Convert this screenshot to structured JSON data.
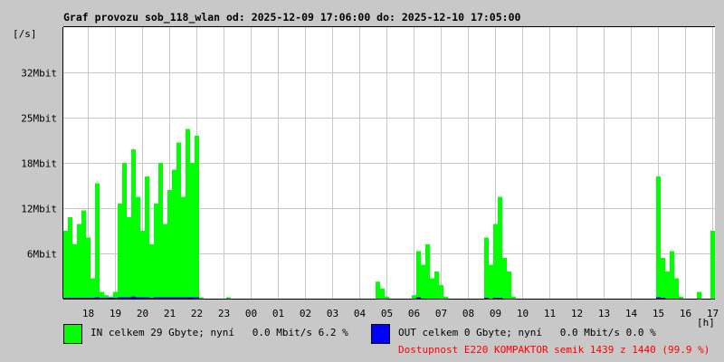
{
  "chart_data": {
    "type": "bar",
    "title": "Graf provozu sob_118_wlan od: 2025-12-09 17:06:00 do: 2025-12-10 17:05:00",
    "ylabel": "[/s]",
    "xlabel": "[h]",
    "ylim": [
      0,
      40
    ],
    "y_unit": "Mbit",
    "y_ticks": [
      {
        "value": 6.67,
        "label": "6Mbit"
      },
      {
        "value": 13.33,
        "label": "12Mbit"
      },
      {
        "value": 20,
        "label": "18Mbit"
      },
      {
        "value": 26.67,
        "label": "25Mbit"
      },
      {
        "value": 33.33,
        "label": "32Mbit"
      }
    ],
    "x_ticks": [
      "18",
      "19",
      "20",
      "21",
      "22",
      "23",
      "00",
      "01",
      "02",
      "03",
      "04",
      "05",
      "06",
      "07",
      "08",
      "09",
      "10",
      "11",
      "12",
      "13",
      "14",
      "15",
      "16",
      "17"
    ],
    "sample_interval_min": 10,
    "grid": true,
    "series": [
      {
        "name": "IN",
        "color": "#00ff00",
        "values": [
          10,
          12,
          8,
          11,
          13,
          9,
          3,
          17,
          1,
          0.5,
          0.3,
          1,
          14,
          20,
          12,
          22,
          15,
          10,
          18,
          8,
          14,
          20,
          11,
          16,
          19,
          23,
          15,
          25,
          20,
          24,
          0.2,
          0,
          0,
          0,
          0,
          0,
          0.2,
          0,
          0,
          0,
          0,
          0,
          0,
          0,
          0,
          0,
          0,
          0,
          0,
          0,
          0,
          0,
          0,
          0,
          0,
          0,
          0,
          0,
          0,
          0,
          0,
          0,
          0,
          0,
          0,
          0,
          0,
          0,
          0,
          2.5,
          1.5,
          0.3,
          0,
          0,
          0,
          0,
          0,
          0.5,
          7,
          5,
          8,
          3,
          4,
          2,
          0.3,
          0,
          0,
          0,
          0,
          0,
          0,
          0,
          0,
          9,
          5,
          11,
          15,
          6,
          4,
          0.3,
          0,
          0,
          0,
          0,
          0,
          0,
          0,
          0,
          0,
          0,
          0,
          0,
          0,
          0,
          0,
          0,
          0,
          0,
          0,
          0,
          0,
          0,
          0,
          0,
          0,
          0,
          0,
          0,
          0,
          0,
          0,
          18,
          6,
          4,
          7,
          3,
          0.3,
          0,
          0,
          0,
          1,
          0,
          0,
          10
        ]
      },
      {
        "name": "OUT",
        "color": "#0000ff",
        "values": [
          0.1,
          0.1,
          0.1,
          0.1,
          0.1,
          0.1,
          0.1,
          0.2,
          0.1,
          0.1,
          0.1,
          0.1,
          0.2,
          0.2,
          0.2,
          0.3,
          0.2,
          0.2,
          0.2,
          0.1,
          0.2,
          0.2,
          0.2,
          0.2,
          0.2,
          0.2,
          0.2,
          0.2,
          0.2,
          0.2,
          0,
          0,
          0,
          0,
          0,
          0,
          0,
          0,
          0,
          0,
          0,
          0,
          0,
          0,
          0,
          0,
          0,
          0,
          0,
          0,
          0,
          0,
          0,
          0,
          0,
          0,
          0,
          0,
          0,
          0,
          0,
          0,
          0,
          0,
          0,
          0,
          0,
          0,
          0,
          0,
          0,
          0,
          0,
          0,
          0,
          0,
          0,
          0,
          0.2,
          0,
          0,
          0,
          0,
          0,
          0,
          0,
          0,
          0,
          0,
          0,
          0,
          0,
          0,
          0.1,
          0,
          0.1,
          0.1,
          0,
          0,
          0,
          0,
          0,
          0,
          0,
          0,
          0,
          0,
          0,
          0,
          0,
          0,
          0,
          0,
          0,
          0,
          0,
          0,
          0,
          0,
          0,
          0,
          0,
          0,
          0,
          0,
          0,
          0,
          0,
          0,
          0,
          0,
          0.2,
          0.1,
          0,
          0,
          0,
          0,
          0,
          0,
          0,
          0,
          0,
          0,
          0
        ]
      }
    ]
  },
  "legend": {
    "in_text": "IN celkem 29 Gbyte; nyní   0.0 Mbit/s 6.2 %",
    "out_text": "OUT celkem 0 Gbyte; nyní   0.0 Mbit/s 0.0 %",
    "availability": "Dostupnost E220 KOMPAKTOR semik 1439 z 1440 (99.9 %)",
    "in_color": "#00ff00",
    "out_color": "#0000ff",
    "availability_color": "#ff0000"
  }
}
